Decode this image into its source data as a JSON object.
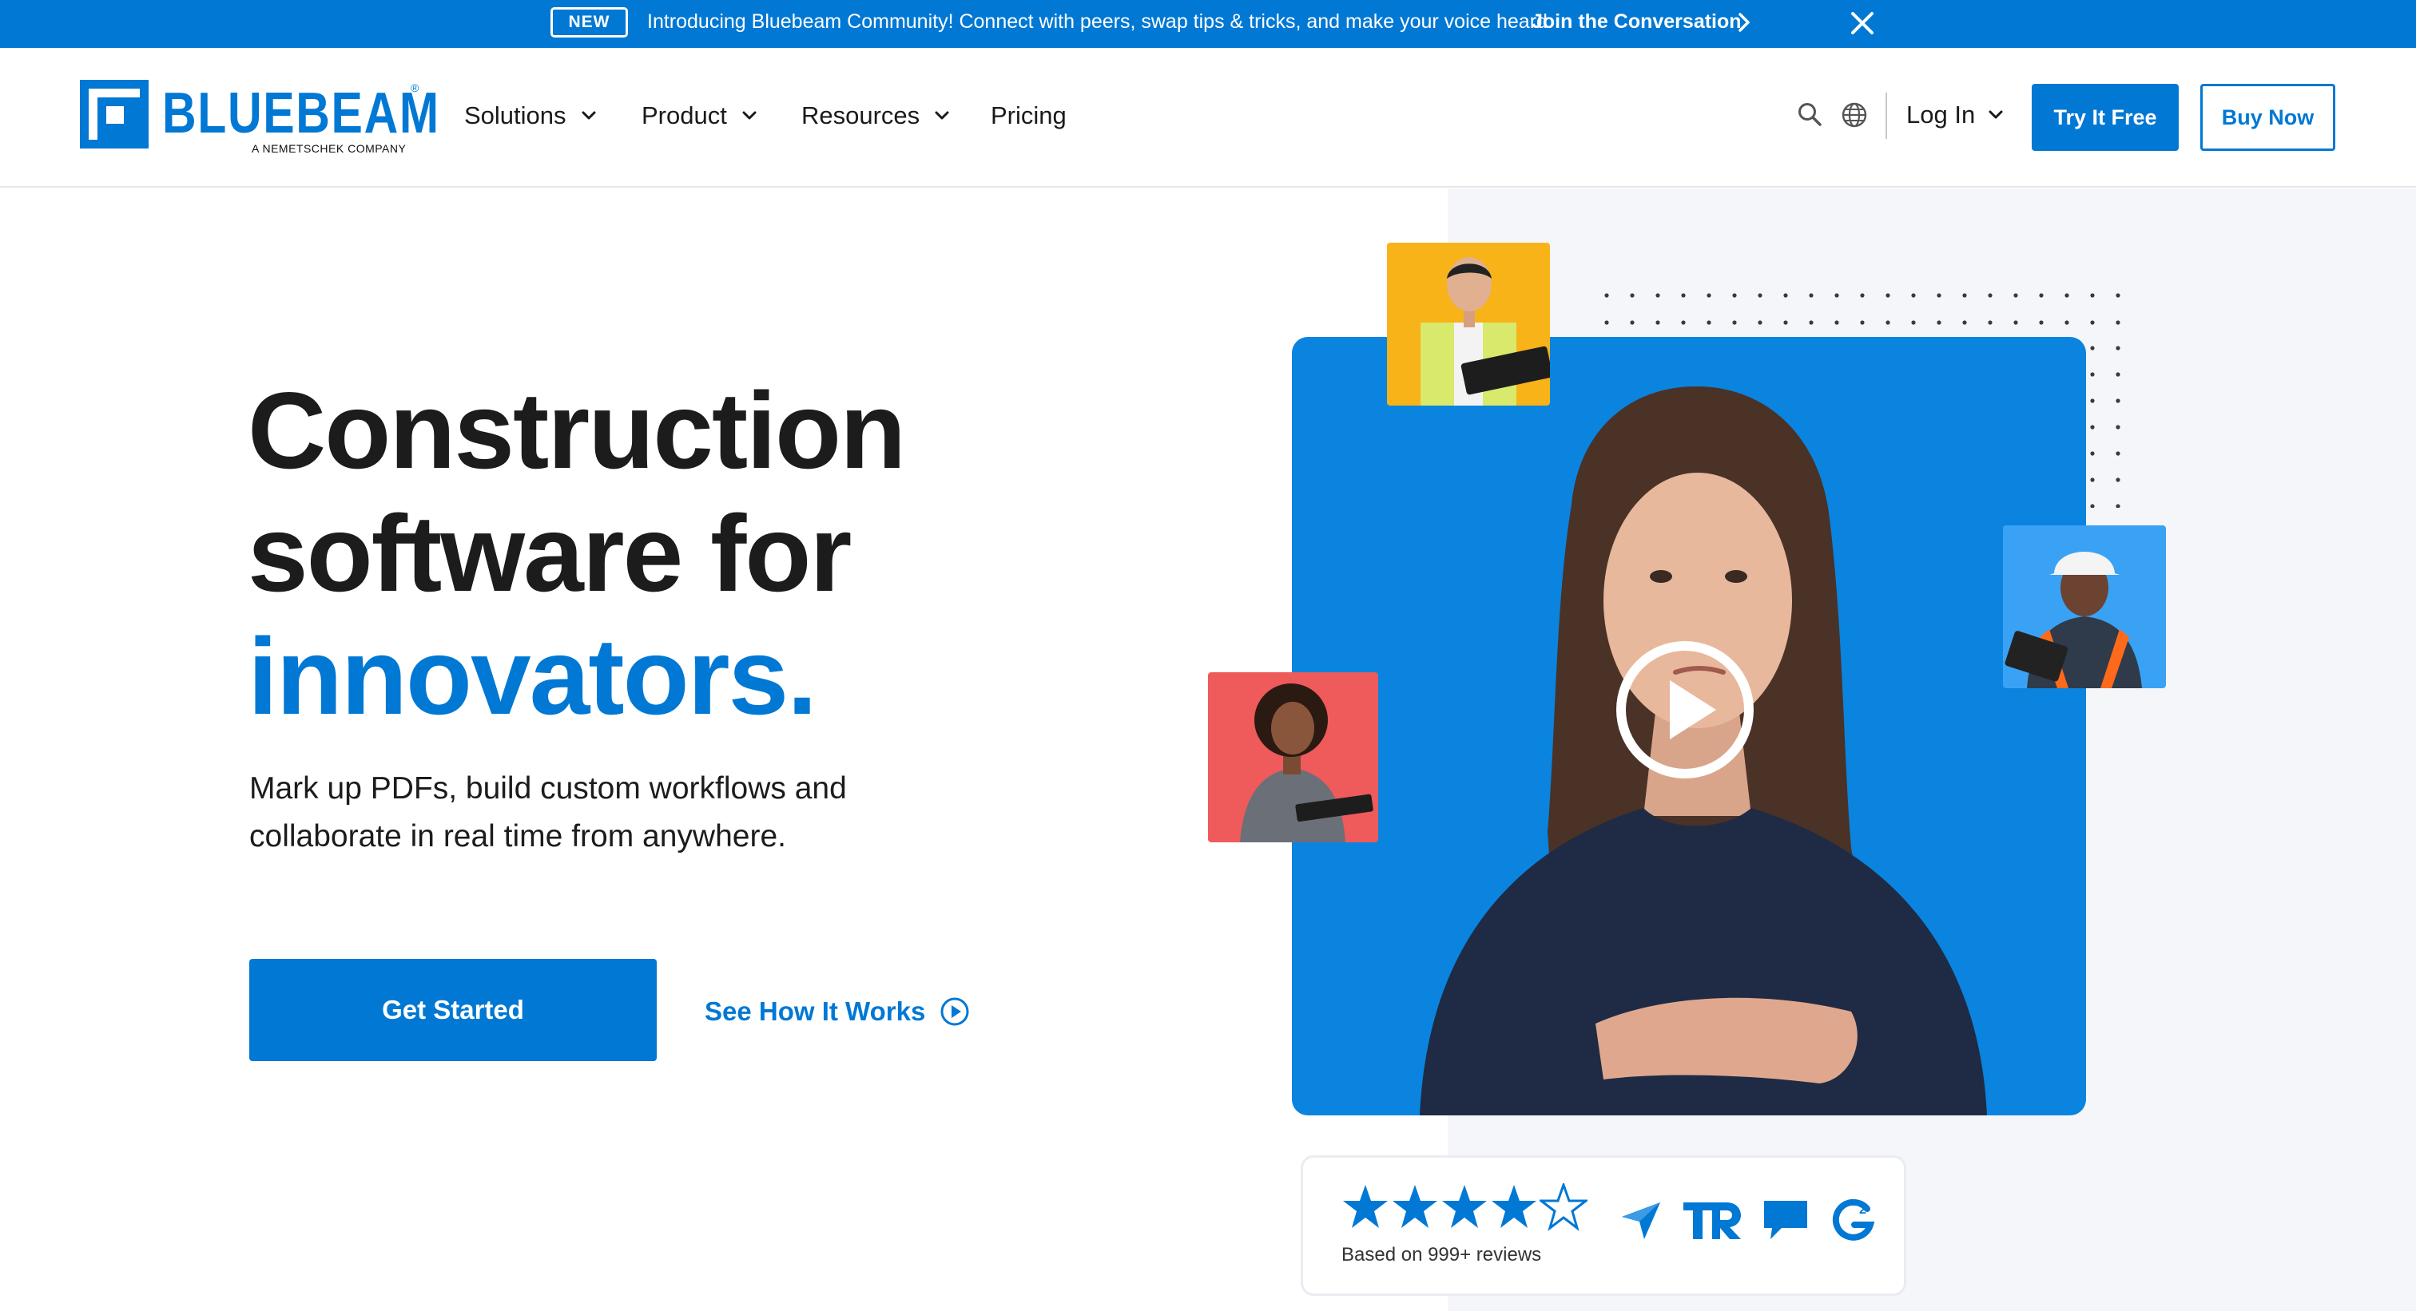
{
  "announcement": {
    "badge": "NEW",
    "message": "Introducing Bluebeam Community! Connect with peers, swap tips & tricks, and make your voice heard.",
    "cta": "Join the Conversation"
  },
  "brand": {
    "name": "BLUEBEAM",
    "registered": "®",
    "tagline": "A NEMETSCHEK COMPANY",
    "accent": "#0078d4"
  },
  "nav": {
    "items": [
      {
        "label": "Solutions",
        "dropdown": true
      },
      {
        "label": "Product",
        "dropdown": true
      },
      {
        "label": "Resources",
        "dropdown": true
      },
      {
        "label": "Pricing",
        "dropdown": false
      }
    ],
    "login": "Log In",
    "try_free": "Try It Free",
    "buy_now": "Buy Now"
  },
  "hero": {
    "headline_line1": "Construction",
    "headline_line2": "software for",
    "headline_accent": "innovators.",
    "subcopy": "Mark up PDFs, build custom workflows and collaborate in real time from anywhere.",
    "primary_cta": "Get Started",
    "secondary_cta": "See How It Works"
  },
  "reviews": {
    "rating": 4.5,
    "max_rating": 5,
    "caption": "Based on 999+ reviews",
    "sources": [
      "capterra-icon",
      "trustradius-icon",
      "software-advice-icon",
      "g2-icon"
    ]
  },
  "icons": {
    "search": "search-icon",
    "globe": "globe-icon",
    "close": "close-icon",
    "play": "play-icon"
  }
}
